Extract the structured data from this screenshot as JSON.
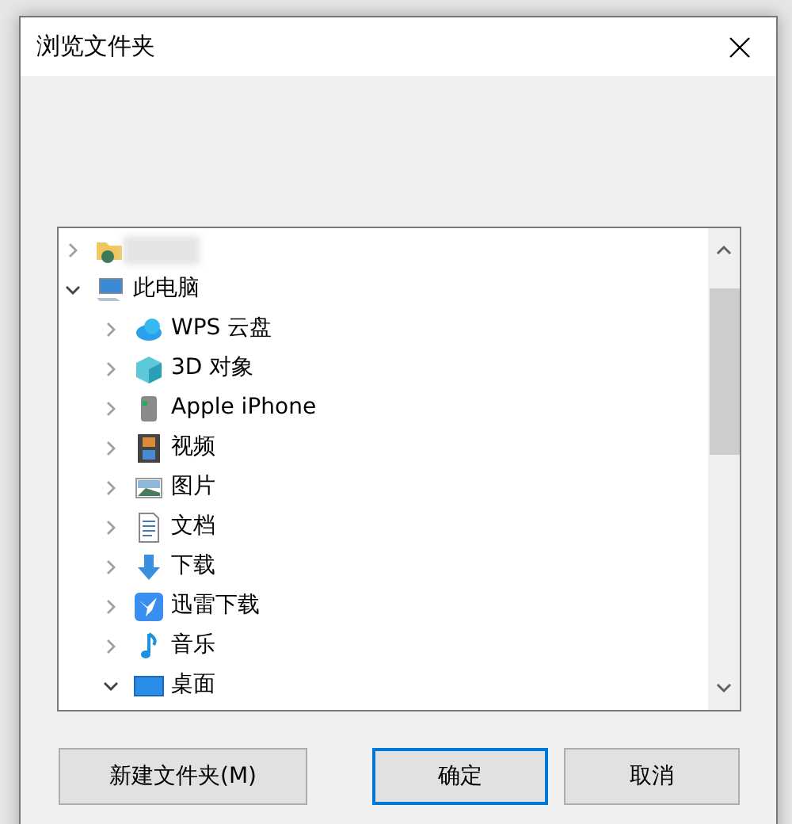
{
  "window": {
    "title": "浏览文件夹"
  },
  "tree": [
    {
      "kind": "user-folder",
      "expanded": false
    },
    {
      "kind": "computer",
      "label": "此电脑",
      "expanded": true,
      "children": [
        {
          "kind": "cloud",
          "label": "WPS 云盘",
          "expanded": false
        },
        {
          "kind": "cube",
          "label": "3D 对象",
          "expanded": false
        },
        {
          "kind": "phone",
          "label": "Apple iPhone",
          "expanded": false
        },
        {
          "kind": "video",
          "label": "视频",
          "expanded": false
        },
        {
          "kind": "image",
          "label": "图片",
          "expanded": false
        },
        {
          "kind": "document",
          "label": "文档",
          "expanded": false
        },
        {
          "kind": "download",
          "label": "下载",
          "expanded": false
        },
        {
          "kind": "bird",
          "label": "迅雷下载",
          "expanded": false
        },
        {
          "kind": "music",
          "label": "音乐",
          "expanded": false
        },
        {
          "kind": "desktop",
          "label": "桌面",
          "expanded": true
        }
      ]
    }
  ],
  "buttons": [
    {
      "label": "新建文件夹(M)",
      "default": false
    },
    {
      "label": "确定",
      "default": true
    },
    {
      "label": "取消",
      "default": false
    }
  ]
}
